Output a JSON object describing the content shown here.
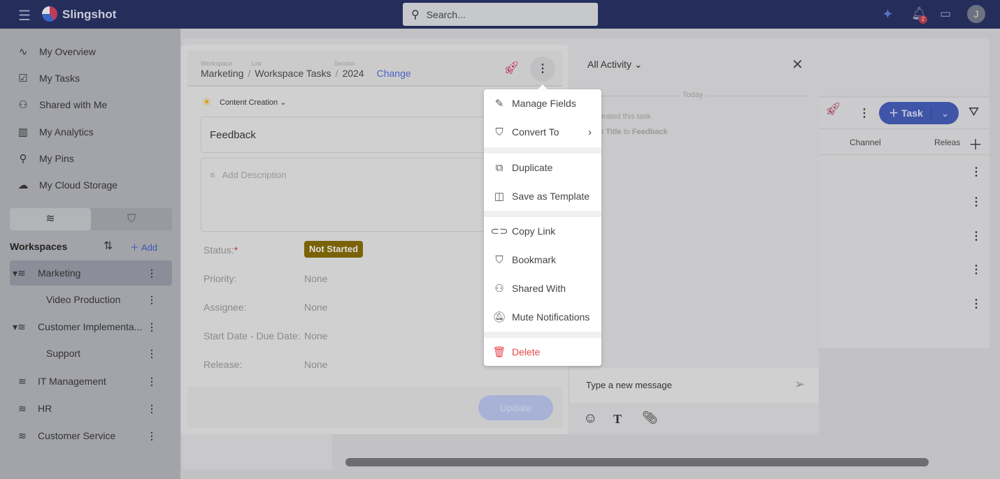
{
  "topbar": {
    "app_name": "Slingshot",
    "search_placeholder": "Search...",
    "notification_count": "2",
    "avatar_initial": "J"
  },
  "sidebar": {
    "items": [
      {
        "label": "My Overview",
        "icon": "pulse-icon"
      },
      {
        "label": "My Tasks",
        "icon": "clipboard-icon"
      },
      {
        "label": "Shared with Me",
        "icon": "user-share-icon"
      },
      {
        "label": "My Analytics",
        "icon": "bar-chart-icon"
      },
      {
        "label": "My Pins",
        "icon": "pin-icon"
      },
      {
        "label": "My Cloud Storage",
        "icon": "cloud-icon"
      }
    ],
    "workspaces_title": "Workspaces",
    "add_label": "Add",
    "workspaces": [
      {
        "label": "Marketing",
        "selected": true,
        "expanded": true
      },
      {
        "label": "Video Production",
        "child": true
      },
      {
        "label": "Customer Implementa...",
        "expanded": true
      },
      {
        "label": "Support",
        "child": true
      },
      {
        "label": "IT Management"
      },
      {
        "label": "HR"
      },
      {
        "label": "Customer Service"
      }
    ]
  },
  "task": {
    "breadcrumb": {
      "workspace_label": "Workspace",
      "workspace": "Marketing",
      "list_label": "List",
      "list": "Workspace Tasks",
      "section_label": "Section",
      "section": "2024",
      "change": "Change"
    },
    "category": "Content Creation",
    "title": "Feedback",
    "description_placeholder": "Add Description",
    "fields": [
      {
        "label": "Status:",
        "value": "Not Started",
        "required": "*"
      },
      {
        "label": "Priority:",
        "value": "None"
      },
      {
        "label": "Assignee:",
        "value": "None"
      },
      {
        "label": "Start Date - Due Date:",
        "value": "None"
      },
      {
        "label": "Release:",
        "value": "None"
      }
    ],
    "update_button": "Update",
    "status_color": "#7a6207"
  },
  "activity": {
    "filter": "All Activity",
    "today": "Today",
    "entry1": "eated this task",
    "entry2_prefix": "t",
    "entry2_field": "Title",
    "entry2_mid": "to",
    "entry2_value": "Feedback",
    "message_placeholder": "Type a new message"
  },
  "background": {
    "task_button": "Task",
    "columns": [
      "Channel",
      "Releas"
    ]
  },
  "menu": {
    "items": [
      "Manage Fields",
      "Convert To",
      "Duplicate",
      "Save as Template",
      "Copy Link",
      "Bookmark",
      "Shared With",
      "Mute Notifications",
      "Delete"
    ],
    "delete_color": "#e8474c"
  }
}
